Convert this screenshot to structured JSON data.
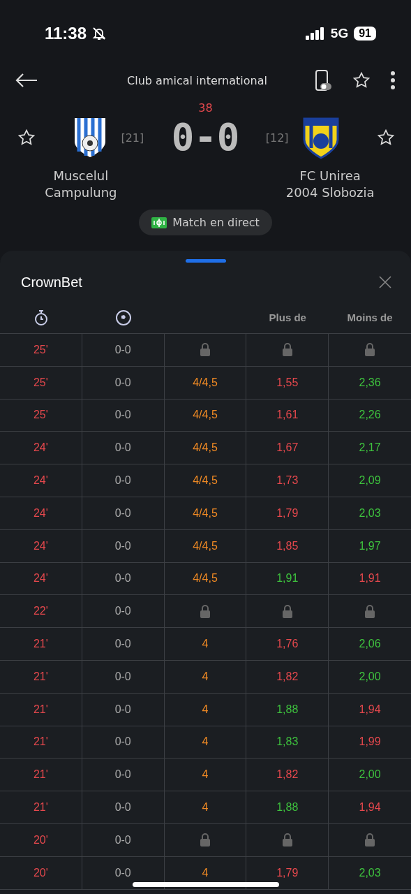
{
  "status_bar": {
    "time": "11:38",
    "network": "5G",
    "battery": "91",
    "silent": true
  },
  "header": {
    "title": "Club amical international"
  },
  "match": {
    "minute": "38",
    "score": "0-0",
    "home": {
      "name": "Muscelul\nCampulung",
      "rank": "[21]"
    },
    "away": {
      "name": "FC Unirea\n2004 Slobozia",
      "rank": "[12]"
    },
    "live_button": "Match en direct"
  },
  "sheet": {
    "title": "CrownBet",
    "columns": [
      {
        "kind": "time-icon"
      },
      {
        "kind": "ball-icon"
      },
      {
        "kind": "empty"
      },
      {
        "kind": "text",
        "label": "Plus de"
      },
      {
        "kind": "text",
        "label": "Moins de"
      }
    ],
    "rows": [
      {
        "time": "25'",
        "score": "0-0",
        "locked": true
      },
      {
        "time": "25'",
        "score": "0-0",
        "locked": false,
        "line": "4/4,5",
        "over": {
          "value": "1,55",
          "color": "#e5484d"
        },
        "under": {
          "value": "2,36",
          "color": "#3ec23e"
        }
      },
      {
        "time": "25'",
        "score": "0-0",
        "locked": false,
        "line": "4/4,5",
        "over": {
          "value": "1,61",
          "color": "#e5484d"
        },
        "under": {
          "value": "2,26",
          "color": "#3ec23e"
        }
      },
      {
        "time": "24'",
        "score": "0-0",
        "locked": false,
        "line": "4/4,5",
        "over": {
          "value": "1,67",
          "color": "#e5484d"
        },
        "under": {
          "value": "2,17",
          "color": "#3ec23e"
        }
      },
      {
        "time": "24'",
        "score": "0-0",
        "locked": false,
        "line": "4/4,5",
        "over": {
          "value": "1,73",
          "color": "#e5484d"
        },
        "under": {
          "value": "2,09",
          "color": "#3ec23e"
        }
      },
      {
        "time": "24'",
        "score": "0-0",
        "locked": false,
        "line": "4/4,5",
        "over": {
          "value": "1,79",
          "color": "#e5484d"
        },
        "under": {
          "value": "2,03",
          "color": "#3ec23e"
        }
      },
      {
        "time": "24'",
        "score": "0-0",
        "locked": false,
        "line": "4/4,5",
        "over": {
          "value": "1,85",
          "color": "#e5484d"
        },
        "under": {
          "value": "1,97",
          "color": "#3ec23e"
        }
      },
      {
        "time": "24'",
        "score": "0-0",
        "locked": false,
        "line": "4/4,5",
        "over": {
          "value": "1,91",
          "color": "#3ec23e"
        },
        "under": {
          "value": "1,91",
          "color": "#e5484d"
        }
      },
      {
        "time": "22'",
        "score": "0-0",
        "locked": true
      },
      {
        "time": "21'",
        "score": "0-0",
        "locked": false,
        "line": "4",
        "over": {
          "value": "1,76",
          "color": "#e5484d"
        },
        "under": {
          "value": "2,06",
          "color": "#3ec23e"
        }
      },
      {
        "time": "21'",
        "score": "0-0",
        "locked": false,
        "line": "4",
        "over": {
          "value": "1,82",
          "color": "#e5484d"
        },
        "under": {
          "value": "2,00",
          "color": "#3ec23e"
        }
      },
      {
        "time": "21'",
        "score": "0-0",
        "locked": false,
        "line": "4",
        "over": {
          "value": "1,88",
          "color": "#3ec23e"
        },
        "under": {
          "value": "1,94",
          "color": "#e5484d"
        }
      },
      {
        "time": "21'",
        "score": "0-0",
        "locked": false,
        "line": "4",
        "over": {
          "value": "1,83",
          "color": "#3ec23e"
        },
        "under": {
          "value": "1,99",
          "color": "#e5484d"
        }
      },
      {
        "time": "21'",
        "score": "0-0",
        "locked": false,
        "line": "4",
        "over": {
          "value": "1,82",
          "color": "#e5484d"
        },
        "under": {
          "value": "2,00",
          "color": "#3ec23e"
        }
      },
      {
        "time": "21'",
        "score": "0-0",
        "locked": false,
        "line": "4",
        "over": {
          "value": "1,88",
          "color": "#3ec23e"
        },
        "under": {
          "value": "1,94",
          "color": "#e5484d"
        }
      },
      {
        "time": "20'",
        "score": "0-0",
        "locked": true
      },
      {
        "time": "20'",
        "score": "0-0",
        "locked": false,
        "line": "4",
        "over": {
          "value": "1,79",
          "color": "#e5484d"
        },
        "under": {
          "value": "2,03",
          "color": "#3ec23e"
        }
      }
    ]
  }
}
